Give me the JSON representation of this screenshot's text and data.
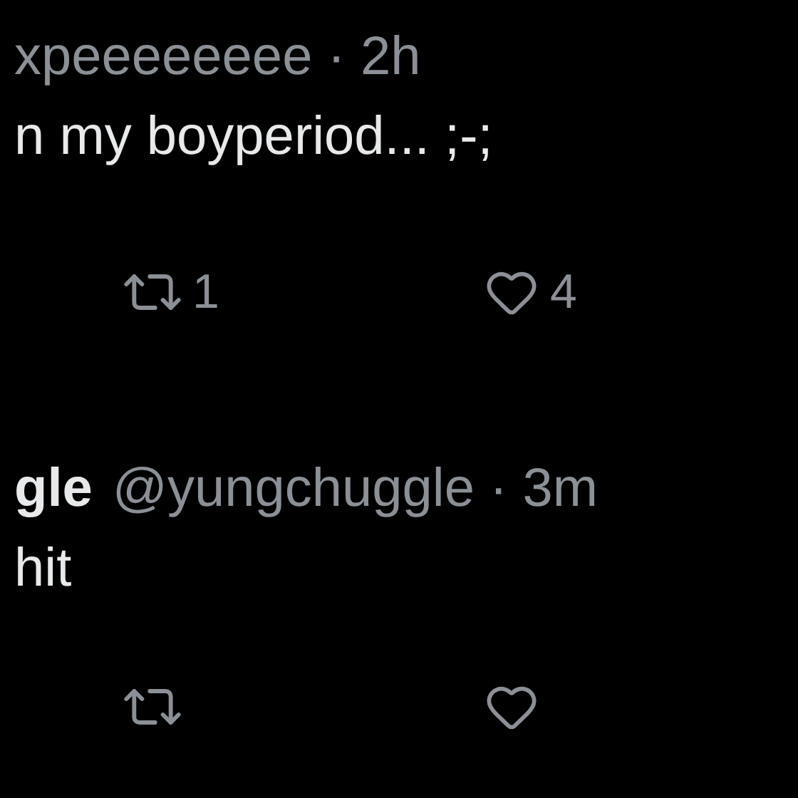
{
  "tweets": [
    {
      "header": [
        {
          "kind": "handle",
          "text": "xpeeeeeeee · 2h"
        }
      ],
      "text": "n my boyperiod... ;-;",
      "retweets": "1",
      "likes": "4"
    },
    {
      "header": [
        {
          "kind": "name",
          "text": "gle"
        },
        {
          "kind": "handle",
          "text": "@yungchuggle · 3m"
        }
      ],
      "text": "hit"
    }
  ]
}
